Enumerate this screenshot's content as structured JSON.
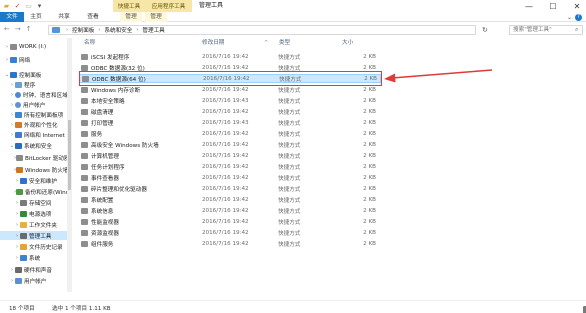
{
  "title_bar": {
    "window_title": "管理工具",
    "ctx_tab_shortcut": "快捷工具",
    "ctx_tab_app": "应用程序工具",
    "minimize_glyph": "—",
    "maximize_glyph": "☐",
    "close_glyph": "✕"
  },
  "ribbon": {
    "tabs": [
      "文件",
      "主页",
      "共享",
      "查看",
      "管理",
      "管理"
    ],
    "help_glyph": "?",
    "expand_glyph": "⌄"
  },
  "address": {
    "back_glyph": "←",
    "forward_glyph": "→",
    "up_glyph": "↑",
    "crumbs": [
      "控制面板",
      "系统和安全",
      "管理工具"
    ],
    "search_placeholder": "搜索\"管理工具\"",
    "refresh_glyph": "↻"
  },
  "sidebar": {
    "items": [
      {
        "label": "WORK (I:)",
        "icon": "drive-icon"
      },
      {
        "label": "网络",
        "icon": "network-icon"
      },
      {
        "label": "控制面板",
        "icon": "control-panel-icon"
      },
      {
        "label": "程序",
        "icon": "programs-icon"
      },
      {
        "label": "时钟、语言和区域",
        "icon": "clock-icon"
      },
      {
        "label": "用户帐户",
        "icon": "user-icon"
      },
      {
        "label": "所有控制面板项",
        "icon": "all-items-icon"
      },
      {
        "label": "外观和个性化",
        "icon": "appearance-icon"
      },
      {
        "label": "网络和 Internet",
        "icon": "network-internet-icon"
      },
      {
        "label": "系统和安全",
        "icon": "security-icon"
      },
      {
        "label": "BitLocker 驱动器加密",
        "icon": "bitlocker-icon"
      },
      {
        "label": "Windows 防火墙",
        "icon": "firewall-icon"
      },
      {
        "label": "安全和维护",
        "icon": "security-maintenance-icon"
      },
      {
        "label": "备份和还原(Windows 7)",
        "icon": "backup-icon"
      },
      {
        "label": "存储空间",
        "icon": "storage-icon"
      },
      {
        "label": "电源选项",
        "icon": "power-icon"
      },
      {
        "label": "工作文件夹",
        "icon": "work-folders-icon"
      },
      {
        "label": "管理工具",
        "icon": "admin-tools-icon"
      },
      {
        "label": "文件历史记录",
        "icon": "file-history-icon"
      },
      {
        "label": "系统",
        "icon": "system-icon"
      },
      {
        "label": "硬件和声音",
        "icon": "hardware-icon"
      },
      {
        "label": "用户帐户",
        "icon": "user-accounts-icon"
      }
    ]
  },
  "list": {
    "headers": {
      "name": "名称",
      "date": "修改日期",
      "type": "类型",
      "size": "大小"
    },
    "sort_glyph": "^",
    "rows": [
      {
        "name": "iSCSI 发起程序",
        "date": "2016/7/16 19:42",
        "type": "快捷方式",
        "size": "2 KB"
      },
      {
        "name": "ODBC 数据源(32 位)",
        "date": "2016/7/16 19:42",
        "type": "快捷方式",
        "size": "2 KB"
      },
      {
        "name": "ODBC 数据源(64 位)",
        "date": "2016/7/16 19:42",
        "type": "快捷方式",
        "size": "2 KB"
      },
      {
        "name": "Windows 内存诊断",
        "date": "2016/7/16 19:42",
        "type": "快捷方式",
        "size": "2 KB"
      },
      {
        "name": "本地安全策略",
        "date": "2016/7/16 19:43",
        "type": "快捷方式",
        "size": "2 KB"
      },
      {
        "name": "磁盘清理",
        "date": "2016/7/16 19:42",
        "type": "快捷方式",
        "size": "2 KB"
      },
      {
        "name": "打印管理",
        "date": "2016/7/16 19:43",
        "type": "快捷方式",
        "size": "2 KB"
      },
      {
        "name": "服务",
        "date": "2016/7/16 19:42",
        "type": "快捷方式",
        "size": "2 KB"
      },
      {
        "name": "高级安全 Windows 防火墙",
        "date": "2016/7/16 19:42",
        "type": "快捷方式",
        "size": "2 KB"
      },
      {
        "name": "计算机管理",
        "date": "2016/7/16 19:42",
        "type": "快捷方式",
        "size": "2 KB"
      },
      {
        "name": "任务计划程序",
        "date": "2016/7/16 19:42",
        "type": "快捷方式",
        "size": "2 KB"
      },
      {
        "name": "事件查看器",
        "date": "2016/7/16 19:42",
        "type": "快捷方式",
        "size": "2 KB"
      },
      {
        "name": "碎片整理和优化驱动器",
        "date": "2016/7/16 19:42",
        "type": "快捷方式",
        "size": "2 KB"
      },
      {
        "name": "系统配置",
        "date": "2016/7/16 19:42",
        "type": "快捷方式",
        "size": "2 KB"
      },
      {
        "name": "系统信息",
        "date": "2016/7/16 19:42",
        "type": "快捷方式",
        "size": "2 KB"
      },
      {
        "name": "性能监视器",
        "date": "2016/7/16 19:42",
        "type": "快捷方式",
        "size": "2 KB"
      },
      {
        "name": "资源监视器",
        "date": "2016/7/16 19:42",
        "type": "快捷方式",
        "size": "2 KB"
      },
      {
        "name": "组件服务",
        "date": "2016/7/16 19:42",
        "type": "快捷方式",
        "size": "2 KB"
      }
    ],
    "selected_index": 2
  },
  "status": {
    "count": "18 个项目",
    "selection": "选中 1 个项目  1.11 KB"
  },
  "colors": {
    "accent": "#1979ca",
    "selection": "#cce8ff",
    "annotation": "#e03a3a"
  }
}
